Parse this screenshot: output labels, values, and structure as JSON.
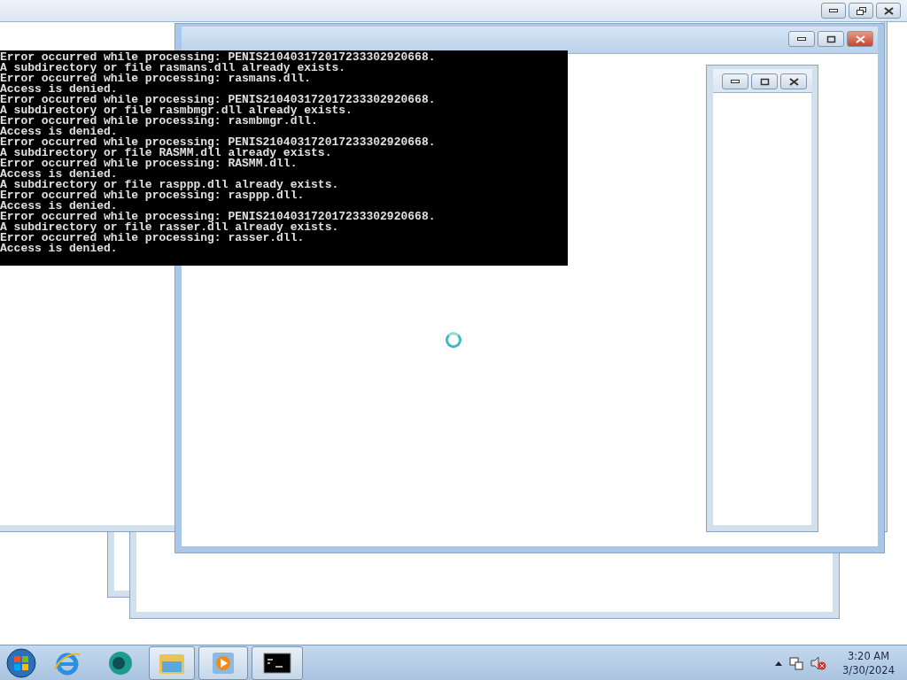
{
  "console": {
    "lines": [
      "Error occurred while processing: PENIS210403172017233302920668.",
      "A subdirectory or file rasmans.dll already exists.",
      "Error occurred while processing: rasmans.dll.",
      "Access is denied.",
      "Error occurred while processing: PENIS210403172017233302920668.",
      "A subdirectory or file rasmbmgr.dll already exists.",
      "Error occurred while processing: rasmbmgr.dll.",
      "Access is denied.",
      "Error occurred while processing: PENIS210403172017233302920668.",
      "A subdirectory or file RASMM.dll already exists.",
      "Error occurred while processing: RASMM.dll.",
      "Access is denied.",
      "A subdirectory or file rasppp.dll already exists.",
      "Error occurred while processing: rasppp.dll.",
      "Access is denied.",
      "Error occurred while processing: PENIS210403172017233302920668.",
      "A subdirectory or file rasser.dll already exists.",
      "Error occurred while processing: rasser.dll.",
      "Access is denied."
    ]
  },
  "windows": [
    {
      "kind": "maximized",
      "active": false
    },
    {
      "kind": "main",
      "active": true
    },
    {
      "kind": "small",
      "active": false
    }
  ],
  "taskbar": {
    "items": [
      {
        "kind": "start",
        "selected": false
      },
      {
        "kind": "browser",
        "selected": false
      },
      {
        "kind": "app",
        "selected": false
      },
      {
        "kind": "folder",
        "selected": true
      },
      {
        "kind": "media",
        "selected": true
      },
      {
        "kind": "console",
        "selected": true
      }
    ],
    "time": "3:20 AM",
    "date": "3/30/2024"
  }
}
